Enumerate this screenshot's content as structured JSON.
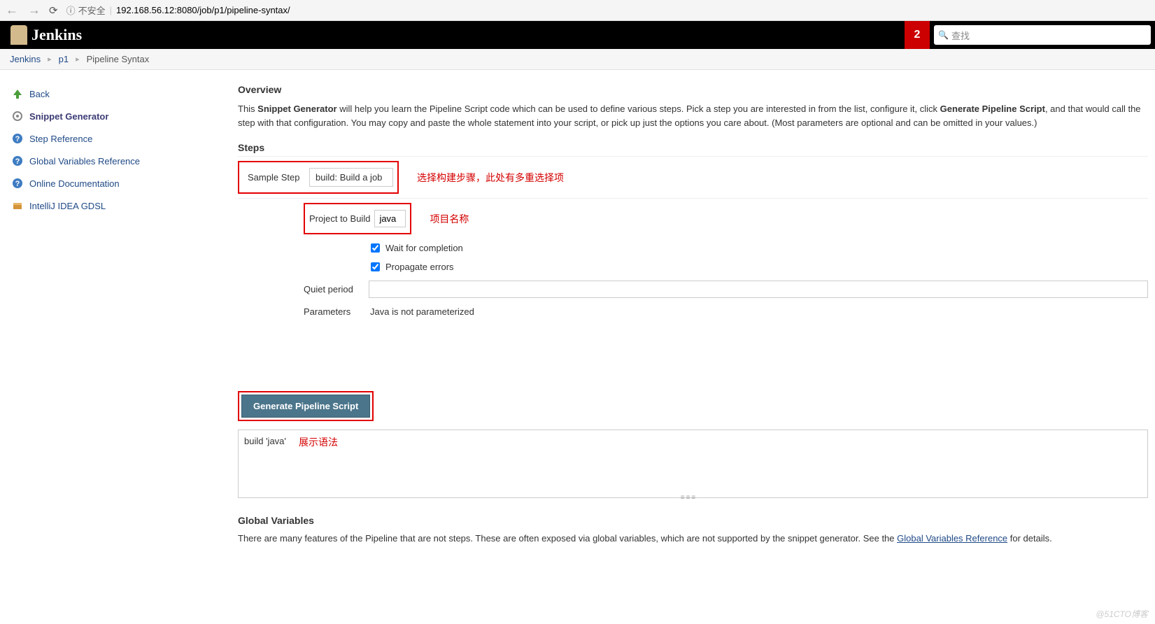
{
  "browser": {
    "insecure": "不安全",
    "url": "192.168.56.12:8080/job/p1/pipeline-syntax/"
  },
  "header": {
    "logo": "Jenkins",
    "notif_count": "2",
    "search_placeholder": "查找"
  },
  "breadcrumb": {
    "items": [
      "Jenkins",
      "p1",
      "Pipeline Syntax"
    ]
  },
  "sidebar": {
    "back": "Back",
    "snippet": "Snippet Generator",
    "stepref": "Step Reference",
    "globalvar": "Global Variables Reference",
    "onlinedoc": "Online Documentation",
    "intellij": "IntelliJ IDEA GDSL"
  },
  "main": {
    "overview_h": "Overview",
    "desc_1": "This ",
    "desc_b1": "Snippet Generator",
    "desc_2": " will help you learn the Pipeline Script code which can be used to define various steps. Pick a step you are interested in from the list, configure it, click ",
    "desc_b2": "Generate Pipeline Script",
    "desc_3": ", and that would call the step with that configuration. You may copy and paste the whole statement into your script, or pick up just the options you care about. (Most parameters are optional and can be omitted in your values.)",
    "steps_h": "Steps",
    "sample_step_label": "Sample Step",
    "sample_step_value": "build: Build a job",
    "sample_step_note": "选择构建步骤，此处有多重选择项",
    "project_label": "Project to Build",
    "project_value": "java",
    "project_note": "项目名称",
    "wait_label": "Wait for completion",
    "propagate_label": "Propagate errors",
    "quiet_label": "Quiet period",
    "params_label": "Parameters",
    "params_value": "Java is not parameterized",
    "gen_btn": "Generate Pipeline Script",
    "output": "build 'java'",
    "output_note": "展示语法",
    "gv_h": "Global Variables",
    "gv_text1": "There are many features of the Pipeline that are not steps. These are often exposed via global variables, which are not supported by the snippet generator. See the ",
    "gv_link": "Global Variables Reference",
    "gv_text2": " for details."
  },
  "watermark": "@51CTO博客"
}
